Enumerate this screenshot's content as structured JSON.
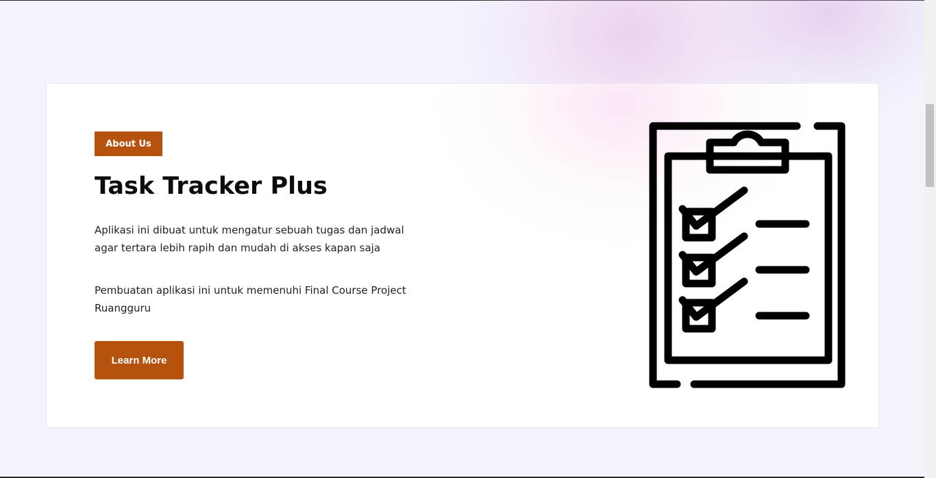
{
  "about": {
    "badge_label": "About Us",
    "title": "Task Tracker Plus",
    "paragraph_1": "Aplikasi ini dibuat untuk mengatur sebuah tugas dan jadwal agar tertara lebih rapih dan mudah di akses kapan saja",
    "paragraph_2": "Pembuatan aplikasi ini untuk memenuhi Final Course Project Ruangguru",
    "cta_label": "Learn More",
    "illustration_icon": "clipboard-checklist-icon"
  },
  "colors": {
    "accent": "#b5520e",
    "page_background": "#f4f3fc",
    "card_background": "#ffffff",
    "text": "#0c0c0c"
  }
}
